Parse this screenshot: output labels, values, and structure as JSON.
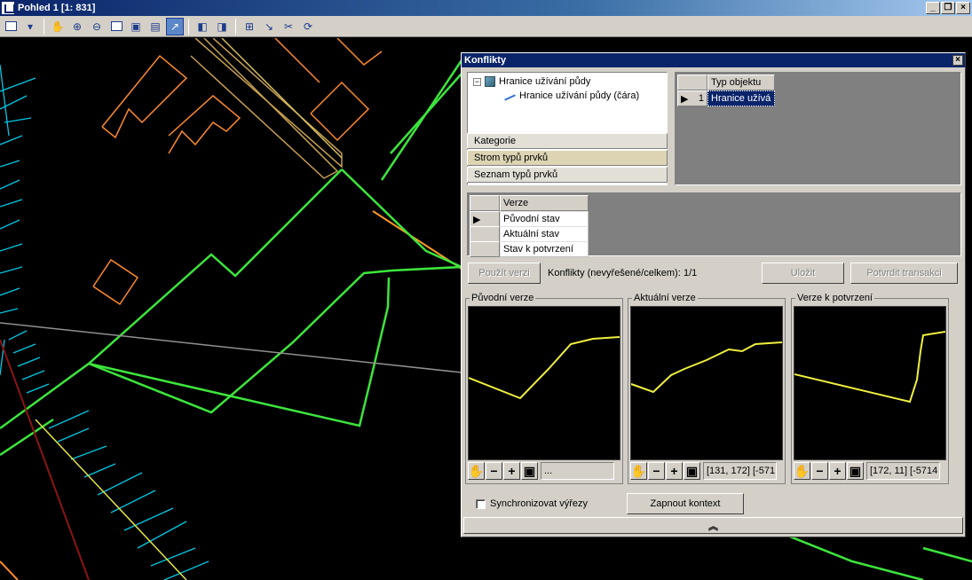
{
  "window": {
    "title": "Pohled 1 [1: 831]",
    "buttons": [
      "_",
      "❐",
      "×"
    ]
  },
  "toolbar": {
    "icons": [
      "layers-icon",
      "dropdown-icon",
      "pan-hand-icon",
      "zoom-in-icon",
      "zoom-out-icon",
      "zoom-window-icon",
      "zoom-all-icon",
      "zoom-extent-icon",
      "select-arrow-icon",
      "previous-view-icon",
      "next-view-icon",
      "snap-icon",
      "measure-icon",
      "tools-icon",
      "refresh-icon"
    ]
  },
  "dialog": {
    "title": "Konflikty",
    "close": "×",
    "tree": {
      "root": "Hranice užívání půdy",
      "child": "Hranice užívání půdy (čára)",
      "expander": "−"
    },
    "tabs": [
      "Kategorie",
      "Strom typů prvků",
      "Seznam typů prvků"
    ],
    "object_grid": {
      "header": "Typ objektu",
      "row_number": "1",
      "row_value": "Hranice užívá"
    },
    "version_grid": {
      "header": "Verze",
      "rows": [
        "Původní stav",
        "Aktuální stav",
        "Stav k potvrzení"
      ]
    },
    "apply_version": "Použít verzi",
    "conflicts_label": "Konflikty (nevyřešené/celkem):",
    "conflicts_value": "1/1",
    "save": "Uložit",
    "confirm": "Potvrdit transakci",
    "panels": [
      {
        "title": "Původní verze",
        "coord": "..."
      },
      {
        "title": "Aktuální verze",
        "coord": "[131, 172] [-571"
      },
      {
        "title": "Verze k potvrzení",
        "coord": "[172, 11] [-5714"
      }
    ],
    "view_tools": {
      "minus": "−",
      "plus": "+"
    },
    "sync_label": "Synchronizovat výřezy",
    "context_button": "Zapnout kontext",
    "collapse": "︽"
  }
}
